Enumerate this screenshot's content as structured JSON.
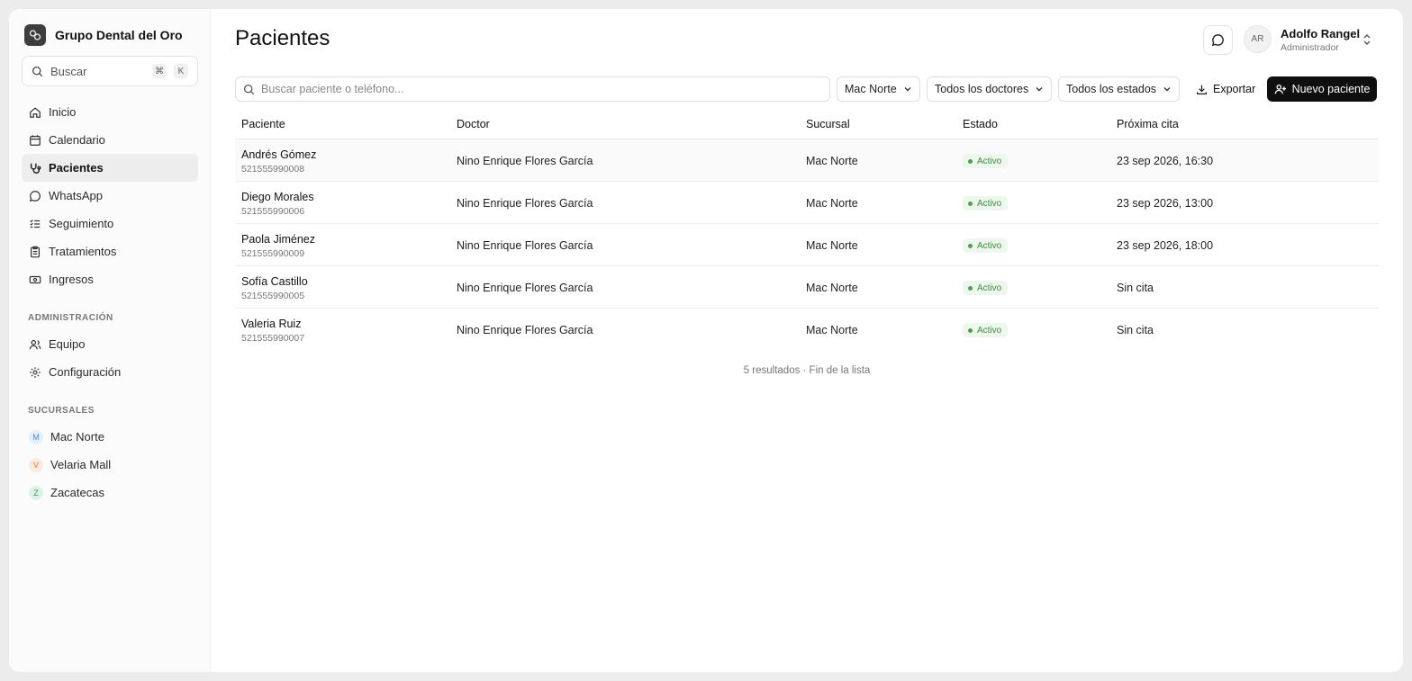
{
  "brand": {
    "name": "Grupo Dental del Oro",
    "logo_icon": "tooth-logo-icon"
  },
  "sidebar": {
    "search": {
      "label": "Buscar",
      "shortcut_mod": "⌘",
      "shortcut_key": "K"
    },
    "nav": [
      {
        "label": "Inicio",
        "icon": "home-icon",
        "active": false
      },
      {
        "label": "Calendario",
        "icon": "calendar-icon",
        "active": false
      },
      {
        "label": "Pacientes",
        "icon": "stethoscope-icon",
        "active": true
      },
      {
        "label": "WhatsApp",
        "icon": "chat-bubble-icon",
        "active": false
      },
      {
        "label": "Seguimiento",
        "icon": "list-checks-icon",
        "active": false
      },
      {
        "label": "Tratamientos",
        "icon": "clipboard-icon",
        "active": false
      },
      {
        "label": "Ingresos",
        "icon": "banknote-icon",
        "active": false
      }
    ],
    "admin_title": "ADMINISTRACIÓN",
    "admin": [
      {
        "label": "Equipo",
        "icon": "users-icon"
      },
      {
        "label": "Configuración",
        "icon": "gear-icon"
      }
    ],
    "branches_title": "SUCURSALES",
    "branches": [
      {
        "initial": "M",
        "label": "Mac Norte",
        "color": "#4f8fd6",
        "bg": "#e3effb"
      },
      {
        "initial": "V",
        "label": "Velaria Mall",
        "color": "#d97a3a",
        "bg": "#fbeadd"
      },
      {
        "initial": "Z",
        "label": "Zacatecas",
        "color": "#3c9a5f",
        "bg": "#dff2e6"
      }
    ]
  },
  "header": {
    "title": "Pacientes",
    "user": {
      "initials": "AR",
      "name": "Adolfo Rangel",
      "role": "Administrador"
    }
  },
  "toolbar": {
    "search_placeholder": "Buscar paciente o teléfono...",
    "branch_filter": "Mac Norte",
    "doctor_filter": "Todos los doctores",
    "status_filter": "Todos los estados",
    "export_label": "Exportar",
    "new_label": "Nuevo paciente"
  },
  "table": {
    "columns": [
      "Paciente",
      "Doctor",
      "Sucursal",
      "Estado",
      "Próxima cita"
    ],
    "rows": [
      {
        "name": "Andrés Gómez",
        "phone": "521555990008",
        "doctor": "Nino Enrique Flores García",
        "branch": "Mac Norte",
        "status": "Activo",
        "next": "23 sep 2026, 16:30"
      },
      {
        "name": "Diego Morales",
        "phone": "521555990006",
        "doctor": "Nino Enrique Flores García",
        "branch": "Mac Norte",
        "status": "Activo",
        "next": "23 sep 2026, 13:00"
      },
      {
        "name": "Paola Jiménez",
        "phone": "521555990009",
        "doctor": "Nino Enrique Flores García",
        "branch": "Mac Norte",
        "status": "Activo",
        "next": "23 sep 2026, 18:00"
      },
      {
        "name": "Sofía Castillo",
        "phone": "521555990005",
        "doctor": "Nino Enrique Flores García",
        "branch": "Mac Norte",
        "status": "Activo",
        "next": "Sin cita"
      },
      {
        "name": "Valeria Ruiz",
        "phone": "521555990007",
        "doctor": "Nino Enrique Flores García",
        "branch": "Mac Norte",
        "status": "Activo",
        "next": "Sin cita"
      }
    ],
    "footer": "5 resultados · Fin de la lista"
  },
  "colors": {
    "accent": "#0f0f0f",
    "status_active": "#3e8a3e",
    "status_active_bg": "#eef7ee"
  }
}
